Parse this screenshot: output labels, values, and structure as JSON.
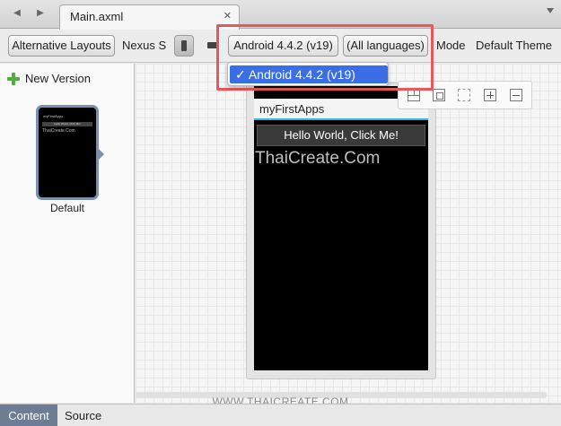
{
  "tabbar": {
    "tab_title": "Main.axml",
    "close_glyph": "✕",
    "back_glyph": "◀",
    "forward_glyph": "▶"
  },
  "toolbar": {
    "alternative_layouts": "Alternative Layouts",
    "device": "Nexus S",
    "api_level": "Android 4.4.2 (v19)",
    "languages": "(All languages)",
    "mode": "Mode",
    "theme": "Default Theme"
  },
  "dropdown": {
    "selected_item": "✓ Android 4.4.2 (v19)"
  },
  "left_panel": {
    "new_version": "New Version",
    "thumbnail_label": "Default",
    "thumbnail_title": "myFirstApps",
    "thumbnail_button": "Hello World, Click Me!",
    "thumbnail_text": "ThaiCreate.Com"
  },
  "device": {
    "app_title": "myFirstApps",
    "button_label": "Hello World, Click Me!",
    "text_view": "ThaiCreate.Com"
  },
  "watermark": "WWW.THAICREATE.COM",
  "bottom_tabs": {
    "content": "Content",
    "source": "Source"
  },
  "colors": {
    "highlight_border": "#e8575a",
    "selection": "#3a6ee7",
    "accent_line": "#33b5e5",
    "active_tab": "#6e7c94"
  }
}
